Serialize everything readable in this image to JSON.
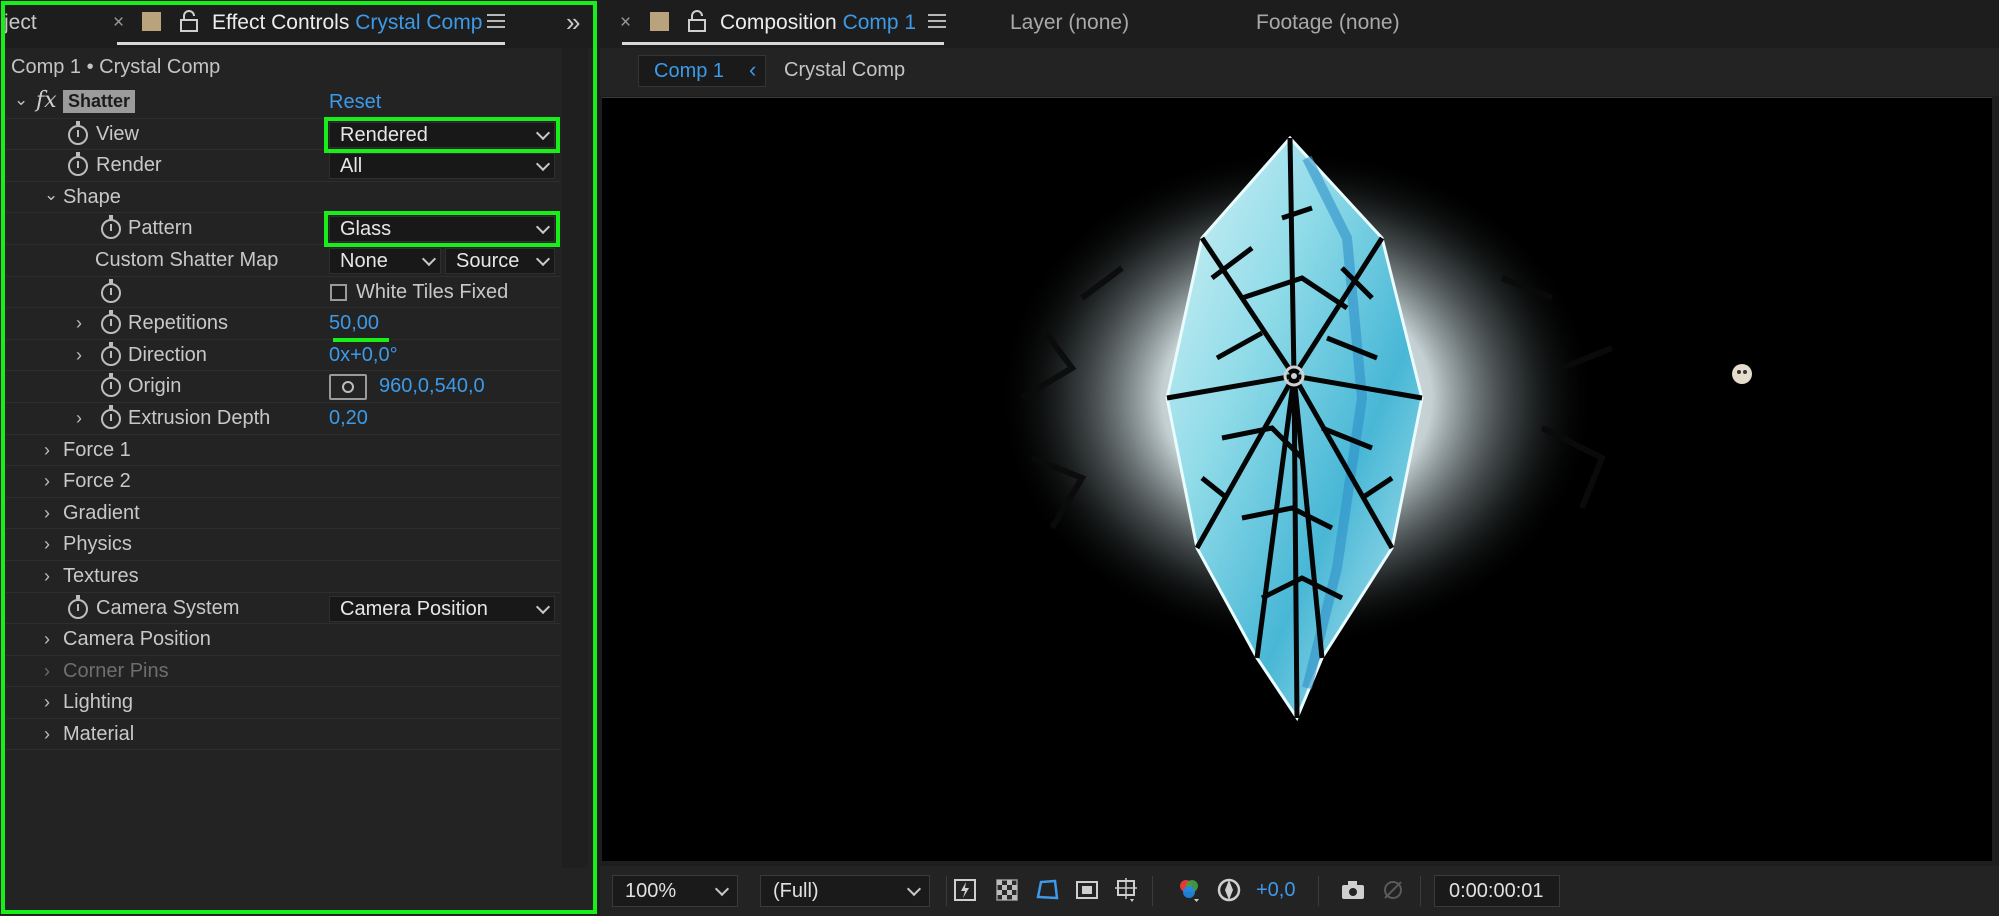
{
  "left_panel": {
    "tab_partial": "ject",
    "tab_title": "Effect Controls",
    "tab_comp": "Crystal Comp",
    "expand_glyph": "»",
    "close_glyph": "×",
    "breadcrumb": "Comp 1 • Crystal Comp",
    "effect": {
      "name": "Shatter",
      "fx_glyph": "fx",
      "reset_label": "Reset",
      "view": {
        "label": "View",
        "value": "Rendered"
      },
      "render": {
        "label": "Render",
        "value": "All"
      },
      "shape": {
        "label": "Shape",
        "pattern": {
          "label": "Pattern",
          "value": "Glass"
        },
        "custom_shatter_map": {
          "label": "Custom Shatter Map",
          "value": "None",
          "source": "Source"
        },
        "white_tiles_fixed": {
          "label": "White Tiles Fixed",
          "checked": false
        },
        "repetitions": {
          "label": "Repetitions",
          "value": "50,00"
        },
        "direction": {
          "label": "Direction",
          "value": "0x+0,0°"
        },
        "origin": {
          "label": "Origin",
          "value": "960,0,540,0"
        },
        "extrusion_depth": {
          "label": "Extrusion Depth",
          "value": "0,20"
        }
      },
      "groups": {
        "force1": "Force 1",
        "force2": "Force 2",
        "gradient": "Gradient",
        "physics": "Physics",
        "textures": "Textures"
      },
      "camera_system": {
        "label": "Camera System",
        "value": "Camera Position"
      },
      "camera_position": "Camera Position",
      "corner_pins": "Corner Pins",
      "lighting": "Lighting",
      "material": "Material"
    },
    "highlight_color": "#18ef18"
  },
  "right_panel": {
    "close_glyph": "×",
    "tab_title": "Composition",
    "tab_comp": "Comp 1",
    "layer_tab": "Layer (none)",
    "footage_tab": "Footage (none)",
    "viewer_tabs": {
      "active": "Comp 1",
      "other": "Crystal Comp",
      "back_glyph": "‹"
    },
    "bottom_bar": {
      "zoom": "100%",
      "resolution": "(Full)",
      "exposure": "+0,0",
      "timecode": "0:00:00:01"
    }
  },
  "colors": {
    "accent_blue": "#3c9ae8",
    "panel_bg": "#232323",
    "swatch": "#b9a37c"
  }
}
